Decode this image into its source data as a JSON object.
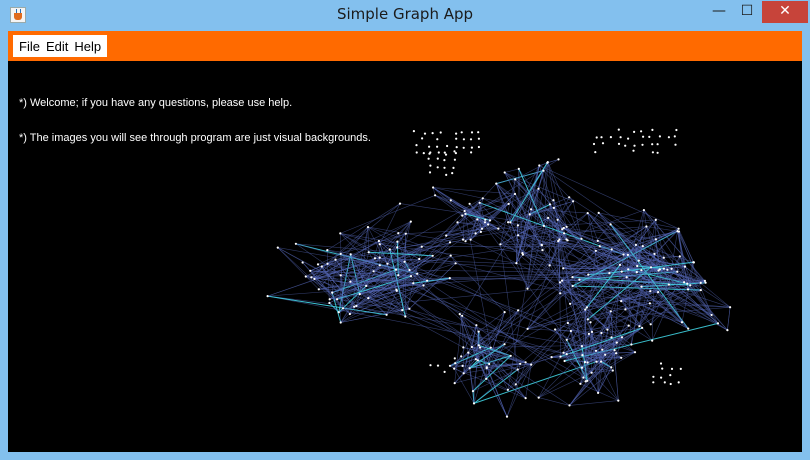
{
  "window": {
    "title": "Simple Graph App",
    "minimize_glyph": "—",
    "maximize_glyph": "☐",
    "close_glyph": "✕"
  },
  "menu": {
    "items": [
      {
        "label": "File"
      },
      {
        "label": "Edit"
      },
      {
        "label": "Help"
      }
    ]
  },
  "canvas": {
    "messages": [
      "*) Welcome; if you have any questions, please use help.",
      "*) The images you will see through program are just visual backgrounds."
    ]
  },
  "colors": {
    "titlebar": "#83c0ee",
    "menubar": "#ff6a00",
    "canvas": "#000000",
    "edge": "#5568b8",
    "edge_highlight": "#3fd0e0",
    "node": "#ffffff",
    "close_button": "#c7443a"
  },
  "icons": {
    "app": "java-cup-icon",
    "minimize": "minimize-icon",
    "maximize": "maximize-icon",
    "close": "close-icon"
  }
}
